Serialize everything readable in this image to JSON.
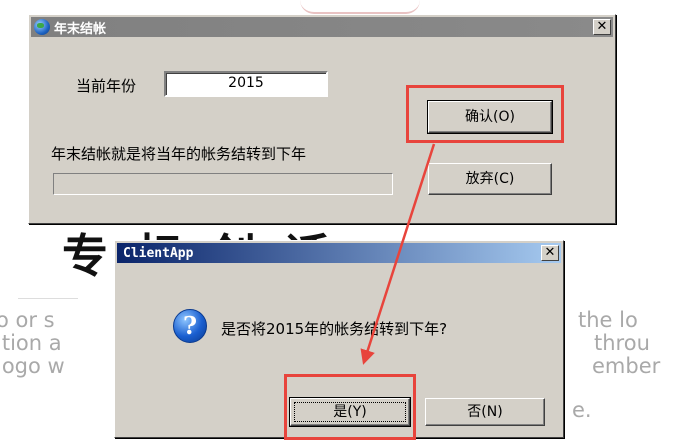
{
  "background": {
    "heading": "专    标    创    话",
    "lines": [
      "o or s",
      "ition a",
      "logo w",
      "the lo",
      "throu",
      "ember",
      "e."
    ]
  },
  "main_window": {
    "title": "年末结帐",
    "close_glyph": "✕",
    "year_label": "当前年份",
    "year_value": "2015",
    "description": "年末结帐就是将当年的帐务结转到下年",
    "confirm_label": "确认(O)",
    "cancel_label": "放弃(C)"
  },
  "dialog": {
    "title": "ClientApp",
    "close_glyph": "✕",
    "icon_glyph": "?",
    "message": "是否将2015年的帐务结转到下年?",
    "yes_label": "是(Y)",
    "no_label": "否(N)"
  },
  "annotation": {
    "highlight_color": "#e8443c"
  }
}
